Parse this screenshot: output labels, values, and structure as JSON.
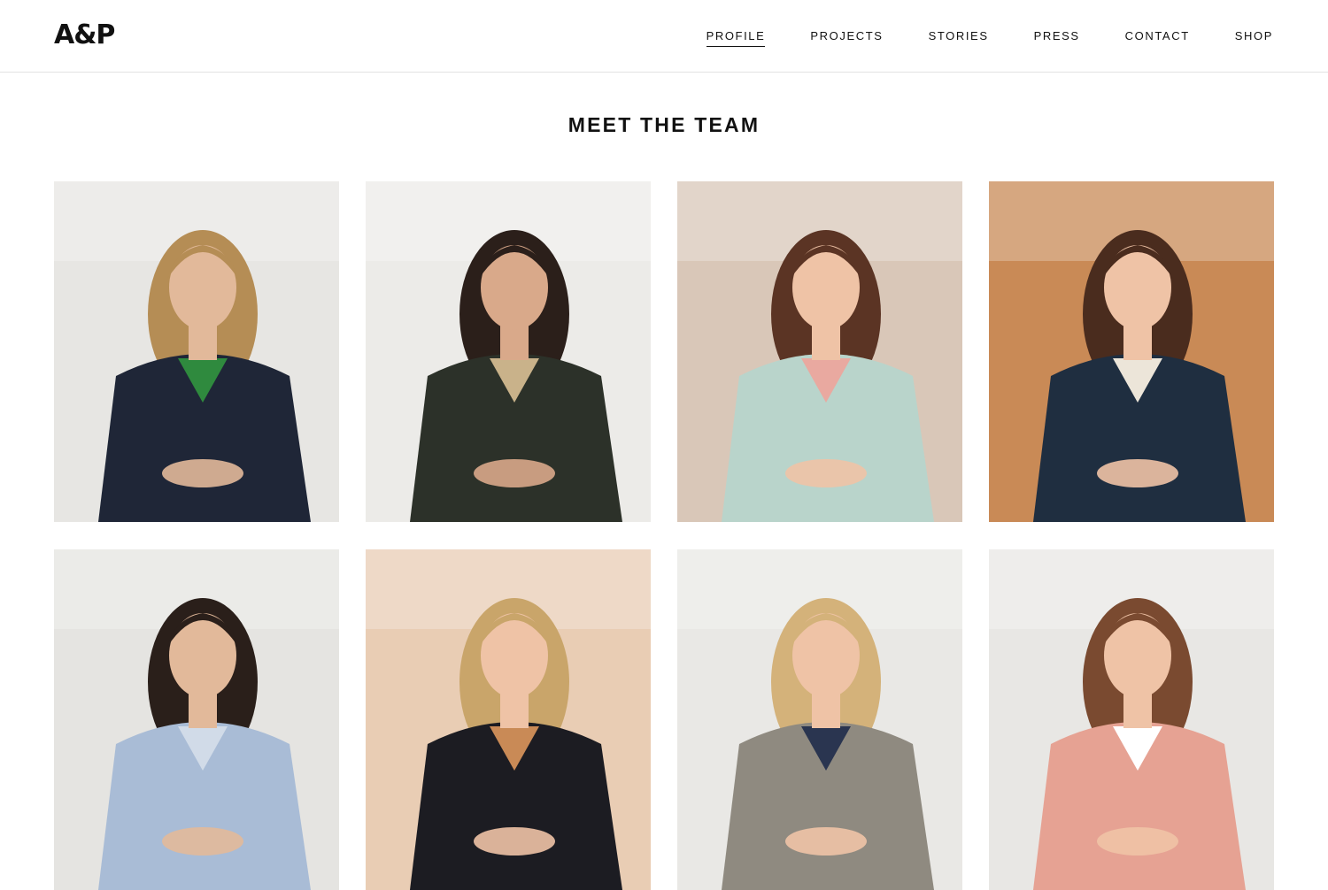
{
  "brand": {
    "logo_text": "A&P"
  },
  "nav": {
    "items": [
      {
        "label": "PROFILE",
        "active": true
      },
      {
        "label": "PROJECTS",
        "active": false
      },
      {
        "label": "STORIES",
        "active": false
      },
      {
        "label": "PRESS",
        "active": false
      },
      {
        "label": "CONTACT",
        "active": false
      },
      {
        "label": "SHOP",
        "active": false
      }
    ]
  },
  "team": {
    "title": "MEET THE TEAM",
    "members": [
      {
        "photo": "portrait-curly-blonde-navy-blazer-green-shirt",
        "bg": "#e7e6e3",
        "hair": "#b58d55",
        "top": "#1f2637",
        "accent": "#2f8a3e",
        "skin": "#e2b99a"
      },
      {
        "photo": "portrait-dark-hair-floral-dress",
        "bg": "#ecebe8",
        "hair": "#2b1f1a",
        "top": "#2c3129",
        "accent": "#c9b28a",
        "skin": "#d9a98a"
      },
      {
        "photo": "portrait-bob-hair-mint-top",
        "bg": "#d9c7b8",
        "hair": "#5b3424",
        "top": "#b9d4cb",
        "accent": "#e9a9a0",
        "skin": "#efc3a6"
      },
      {
        "photo": "portrait-long-hair-navy-dress-armchair",
        "bg": "#c98a56",
        "hair": "#4a2c1e",
        "top": "#1f2e40",
        "accent": "#ece5d9",
        "skin": "#efc3a6"
      },
      {
        "photo": "portrait-dark-hair-light-blue-jacket",
        "bg": "#e5e4e1",
        "hair": "#2a1f1a",
        "top": "#a9bcd6",
        "accent": "#d1dbe8",
        "skin": "#e2b99a"
      },
      {
        "photo": "portrait-blonde-black-blazer",
        "bg": "#e9cdb4",
        "hair": "#c9a56a",
        "top": "#1c1c22",
        "accent": "#c98a56",
        "skin": "#efc3a6"
      },
      {
        "photo": "portrait-blonde-checked-blazer",
        "bg": "#e9e8e5",
        "hair": "#d4b27a",
        "top": "#8f8a80",
        "accent": "#2a3550",
        "skin": "#efc3a6"
      },
      {
        "photo": "portrait-auburn-hair-coral-dress",
        "bg": "#e8e7e4",
        "hair": "#7a4a30",
        "top": "#e6a293",
        "accent": "#ffffff",
        "skin": "#efc3a6"
      }
    ]
  }
}
